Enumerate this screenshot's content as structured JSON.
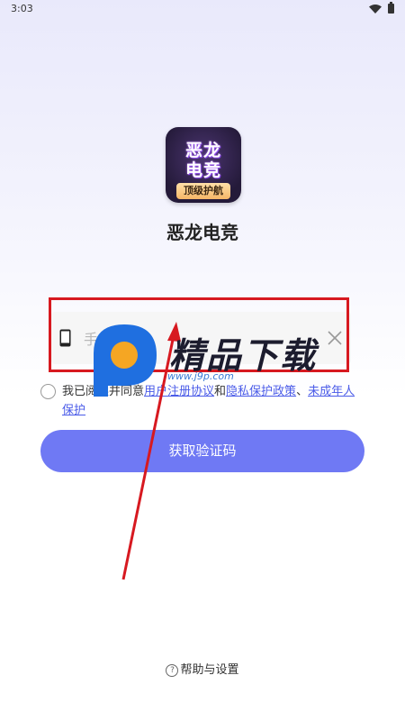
{
  "status_bar": {
    "time": "3:03"
  },
  "app": {
    "logo_line1": "恶龙",
    "logo_line2": "电竞",
    "logo_badge": "顶级护航",
    "name": "恶龙电竞"
  },
  "login": {
    "phone_placeholder": "手机号",
    "agree_prefix": "我已阅读并同意",
    "link_user_agreement": "用户注册协议",
    "connector_and": "和",
    "link_privacy": "隐私保护政策",
    "separator": "、",
    "link_minor": "未成年人保护",
    "get_code_button": "获取验证码"
  },
  "footer": {
    "help_label": "帮助与设置"
  },
  "watermark": {
    "text": "精品下载",
    "url": "www.j9p.com"
  },
  "icons": {
    "phone": "phone-icon",
    "clear": "close-icon",
    "help": "question-circle-icon",
    "wifi": "wifi-icon",
    "battery": "battery-icon"
  },
  "colors": {
    "accent_button": "#6f79f4",
    "link": "#4a5be8",
    "annotation_red": "#d71920",
    "watermark_blue": "#1f6fe0",
    "watermark_orange": "#f5a623"
  }
}
